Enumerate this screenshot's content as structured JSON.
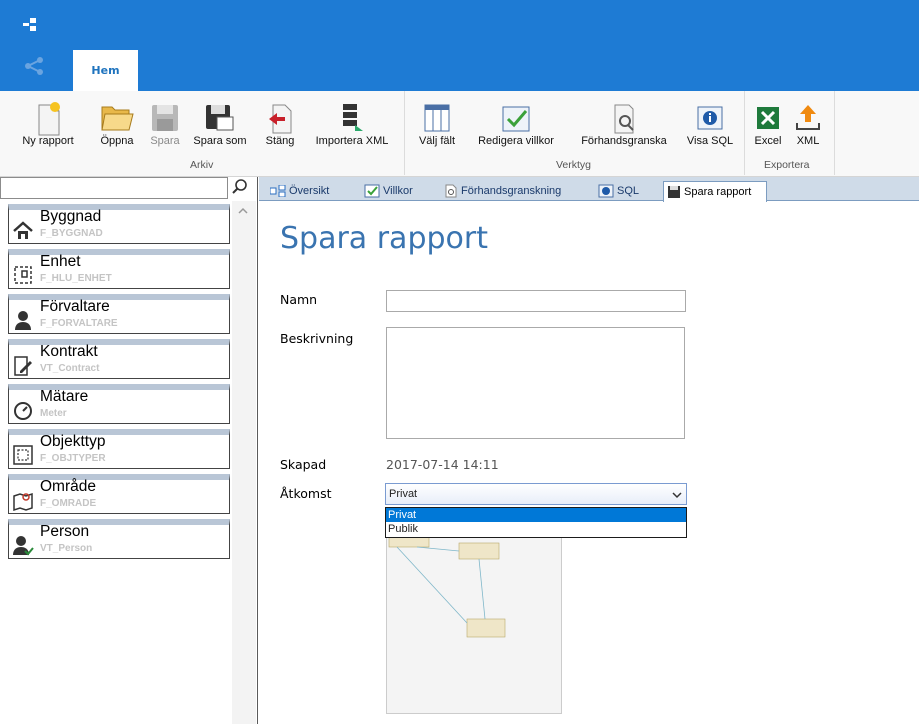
{
  "ribbon": {
    "tab_home": "Hem",
    "groups": {
      "arkiv": "Arkiv",
      "verktyg": "Verktyg",
      "exportera": "Exportera"
    },
    "buttons": {
      "new_report": "Ny rapport",
      "open": "Öppna",
      "save": "Spara",
      "save_as": "Spara som",
      "close": "Stäng",
      "import_xml": "Importera XML",
      "choose_fields": "Välj fält",
      "edit_conditions": "Redigera villkor",
      "preview": "Förhandsgranska",
      "show_sql": "Visa SQL",
      "excel": "Excel",
      "xml": "XML"
    }
  },
  "sidebar": {
    "search": {
      "value": "",
      "placeholder": ""
    },
    "items": [
      {
        "title": "Byggnad",
        "sub": "F_BYGGNAD",
        "icon": "house-icon"
      },
      {
        "title": "Enhet",
        "sub": "F_HLU_ENHET",
        "icon": "floorplan-icon"
      },
      {
        "title": "Förvaltare",
        "sub": "F_FORVALTARE",
        "icon": "manager-icon"
      },
      {
        "title": "Kontrakt",
        "sub": "VT_Contract",
        "icon": "contract-icon"
      },
      {
        "title": "Mätare",
        "sub": "Meter",
        "icon": "meter-icon"
      },
      {
        "title": "Objekttyp",
        "sub": "F_OBJTYPER",
        "icon": "object-type-icon"
      },
      {
        "title": "Område",
        "sub": "F_OMRADE",
        "icon": "area-map-icon"
      },
      {
        "title": "Person",
        "sub": "VT_Person",
        "icon": "person-icon"
      }
    ]
  },
  "content": {
    "tabs": [
      {
        "label": "Översikt"
      },
      {
        "label": "Villkor"
      },
      {
        "label": "Förhandsgranskning"
      },
      {
        "label": "SQL"
      },
      {
        "label": "Spara rapport"
      }
    ],
    "title": "Spara rapport",
    "form": {
      "name_label": "Namn",
      "name_value": "",
      "description_label": "Beskrivning",
      "description_value": "",
      "created_label": "Skapad",
      "created_value": "2017-07-14 14:11",
      "access_label": "Åtkomst",
      "access_selected": "Privat",
      "access_options": [
        "Privat",
        "Publik"
      ]
    }
  },
  "colors": {
    "accent": "#1e7bd4",
    "title_text": "#3a74b0",
    "selected_option": "#0078d7"
  }
}
